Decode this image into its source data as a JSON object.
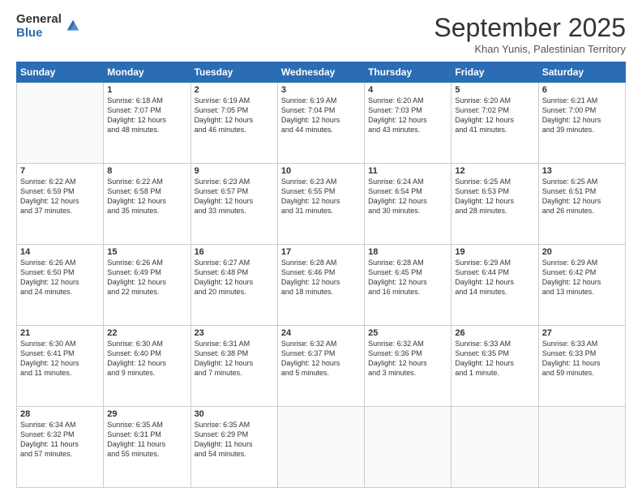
{
  "header": {
    "logo_general": "General",
    "logo_blue": "Blue",
    "month_title": "September 2025",
    "location": "Khan Yunis, Palestinian Territory"
  },
  "weekdays": [
    "Sunday",
    "Monday",
    "Tuesday",
    "Wednesday",
    "Thursday",
    "Friday",
    "Saturday"
  ],
  "weeks": [
    [
      {
        "day": "",
        "content": ""
      },
      {
        "day": "1",
        "content": "Sunrise: 6:18 AM\nSunset: 7:07 PM\nDaylight: 12 hours\nand 48 minutes."
      },
      {
        "day": "2",
        "content": "Sunrise: 6:19 AM\nSunset: 7:05 PM\nDaylight: 12 hours\nand 46 minutes."
      },
      {
        "day": "3",
        "content": "Sunrise: 6:19 AM\nSunset: 7:04 PM\nDaylight: 12 hours\nand 44 minutes."
      },
      {
        "day": "4",
        "content": "Sunrise: 6:20 AM\nSunset: 7:03 PM\nDaylight: 12 hours\nand 43 minutes."
      },
      {
        "day": "5",
        "content": "Sunrise: 6:20 AM\nSunset: 7:02 PM\nDaylight: 12 hours\nand 41 minutes."
      },
      {
        "day": "6",
        "content": "Sunrise: 6:21 AM\nSunset: 7:00 PM\nDaylight: 12 hours\nand 39 minutes."
      }
    ],
    [
      {
        "day": "7",
        "content": "Sunrise: 6:22 AM\nSunset: 6:59 PM\nDaylight: 12 hours\nand 37 minutes."
      },
      {
        "day": "8",
        "content": "Sunrise: 6:22 AM\nSunset: 6:58 PM\nDaylight: 12 hours\nand 35 minutes."
      },
      {
        "day": "9",
        "content": "Sunrise: 6:23 AM\nSunset: 6:57 PM\nDaylight: 12 hours\nand 33 minutes."
      },
      {
        "day": "10",
        "content": "Sunrise: 6:23 AM\nSunset: 6:55 PM\nDaylight: 12 hours\nand 31 minutes."
      },
      {
        "day": "11",
        "content": "Sunrise: 6:24 AM\nSunset: 6:54 PM\nDaylight: 12 hours\nand 30 minutes."
      },
      {
        "day": "12",
        "content": "Sunrise: 6:25 AM\nSunset: 6:53 PM\nDaylight: 12 hours\nand 28 minutes."
      },
      {
        "day": "13",
        "content": "Sunrise: 6:25 AM\nSunset: 6:51 PM\nDaylight: 12 hours\nand 26 minutes."
      }
    ],
    [
      {
        "day": "14",
        "content": "Sunrise: 6:26 AM\nSunset: 6:50 PM\nDaylight: 12 hours\nand 24 minutes."
      },
      {
        "day": "15",
        "content": "Sunrise: 6:26 AM\nSunset: 6:49 PM\nDaylight: 12 hours\nand 22 minutes."
      },
      {
        "day": "16",
        "content": "Sunrise: 6:27 AM\nSunset: 6:48 PM\nDaylight: 12 hours\nand 20 minutes."
      },
      {
        "day": "17",
        "content": "Sunrise: 6:28 AM\nSunset: 6:46 PM\nDaylight: 12 hours\nand 18 minutes."
      },
      {
        "day": "18",
        "content": "Sunrise: 6:28 AM\nSunset: 6:45 PM\nDaylight: 12 hours\nand 16 minutes."
      },
      {
        "day": "19",
        "content": "Sunrise: 6:29 AM\nSunset: 6:44 PM\nDaylight: 12 hours\nand 14 minutes."
      },
      {
        "day": "20",
        "content": "Sunrise: 6:29 AM\nSunset: 6:42 PM\nDaylight: 12 hours\nand 13 minutes."
      }
    ],
    [
      {
        "day": "21",
        "content": "Sunrise: 6:30 AM\nSunset: 6:41 PM\nDaylight: 12 hours\nand 11 minutes."
      },
      {
        "day": "22",
        "content": "Sunrise: 6:30 AM\nSunset: 6:40 PM\nDaylight: 12 hours\nand 9 minutes."
      },
      {
        "day": "23",
        "content": "Sunrise: 6:31 AM\nSunset: 6:38 PM\nDaylight: 12 hours\nand 7 minutes."
      },
      {
        "day": "24",
        "content": "Sunrise: 6:32 AM\nSunset: 6:37 PM\nDaylight: 12 hours\nand 5 minutes."
      },
      {
        "day": "25",
        "content": "Sunrise: 6:32 AM\nSunset: 6:36 PM\nDaylight: 12 hours\nand 3 minutes."
      },
      {
        "day": "26",
        "content": "Sunrise: 6:33 AM\nSunset: 6:35 PM\nDaylight: 12 hours\nand 1 minute."
      },
      {
        "day": "27",
        "content": "Sunrise: 6:33 AM\nSunset: 6:33 PM\nDaylight: 11 hours\nand 59 minutes."
      }
    ],
    [
      {
        "day": "28",
        "content": "Sunrise: 6:34 AM\nSunset: 6:32 PM\nDaylight: 11 hours\nand 57 minutes."
      },
      {
        "day": "29",
        "content": "Sunrise: 6:35 AM\nSunset: 6:31 PM\nDaylight: 11 hours\nand 55 minutes."
      },
      {
        "day": "30",
        "content": "Sunrise: 6:35 AM\nSunset: 6:29 PM\nDaylight: 11 hours\nand 54 minutes."
      },
      {
        "day": "",
        "content": ""
      },
      {
        "day": "",
        "content": ""
      },
      {
        "day": "",
        "content": ""
      },
      {
        "day": "",
        "content": ""
      }
    ]
  ]
}
